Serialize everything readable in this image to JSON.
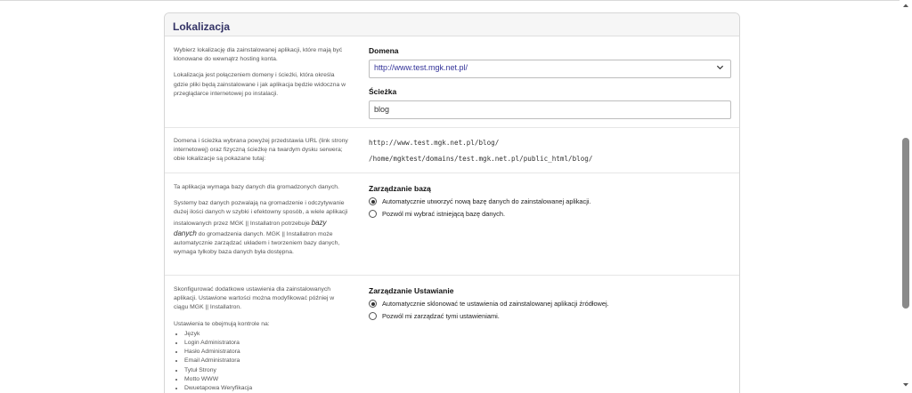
{
  "panel": {
    "title": "Lokalizacja"
  },
  "location": {
    "desc1": "Wybierz lokalizację dla zainstalowanej aplikacji, które mają być klonowane do wewnątrz hosting konta.",
    "desc2": "Lokalizacja jest połączeniem domeny i ścieżki, która określa gdzie pliki będą zainstalowane i jak aplikacja będzie widoczna w przeglądarce internetowej po instalacji.",
    "domain_label": "Domena",
    "domain_value": "http://www.test.mgk.net.pl/",
    "path_label": "Ścieżka",
    "path_value": "blog"
  },
  "urlinfo": {
    "desc": "Domena i ścieżka wybrana powyżej przedstawia URL (link strony internetowej) oraz fizyczną ścieżkę na twardym dysku serwera; obie lokalizacje są pokazane tutaj:",
    "url": "http://www.test.mgk.net.pl/blog/",
    "disk_path": "/home/mgktest/domains/test.mgk.net.pl/public_html/blog/"
  },
  "database": {
    "desc1": "Ta aplikacja wymaga bazy danych dla gromadzonych danych.",
    "desc2_a": "Systemy baz danych pozwalają na gromadzenie i odczytywanie dużej ilości danych w szybki i efektowny sposób, a wiele aplikacji instalowanych przez MGK || Installatron potrzebuje",
    "desc2_em": "bazy danych",
    "desc2_b": "do gromadzenia danych. MGK || Installatron może automatycznie zarządzać układem i tworzeniem bazy danych, wymaga tylkoby baza danych była dostępna.",
    "label": "Zarządzanie bazą",
    "opt_auto": "Automatycznie utworzyć nową bazę danych do zainstalowanej aplikacji.",
    "opt_manual": "Pozwól mi wybrać istniejącą bazę danych."
  },
  "settings": {
    "desc1": "Skonfigurować dodatkowe ustawienia dla zainstalowanych aplikacji. Ustawione wartości można modyfikować później w ciągu MGK || Installatron.",
    "desc2": "Ustawienia te obejmują kontrole na:",
    "items": [
      "Język",
      "Login Administratora",
      "Hasło Administratora",
      "Email Administratora",
      "Tytuł Strony",
      "Motto WWW",
      "Dwuetapowa Weryfikacja"
    ],
    "label": "Zarządzanie Ustawianie",
    "opt_auto": "Automatycznie sklonować te ustawienia od zainstalowanej aplikacji źródłowej.",
    "opt_manual": "Pozwól mi zarządzać tymi ustawieniami."
  },
  "icons": {
    "dropdown": "chevron-down-icon",
    "radio_on": "radio-checked",
    "radio_off": "radio-unchecked"
  }
}
